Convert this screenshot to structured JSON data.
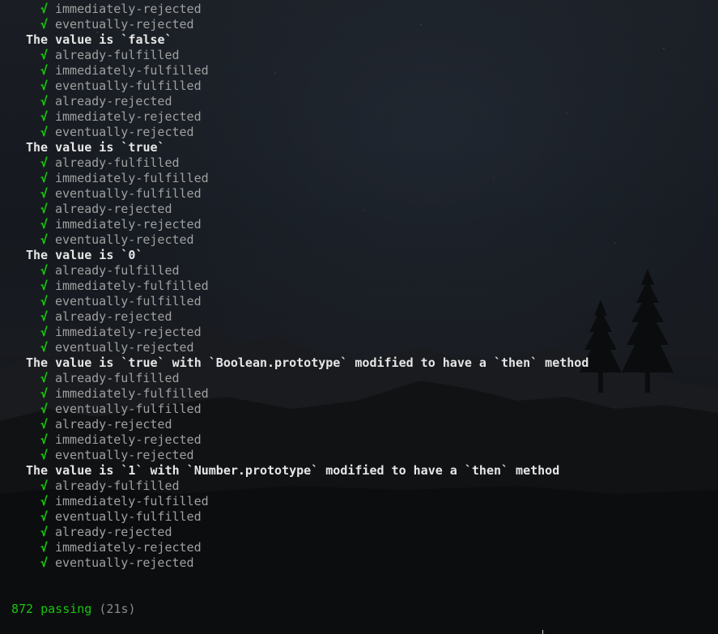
{
  "terminal": {
    "check_glyph": "√",
    "colors": {
      "pass_green": "#16c60c",
      "test_name": "#a0a0a0",
      "suite_title": "#e6e6e6"
    },
    "leading_tests": [
      "immediately-rejected",
      "eventually-rejected"
    ],
    "suites": [
      {
        "title": "The value is `false`",
        "tests": [
          "already-fulfilled",
          "immediately-fulfilled",
          "eventually-fulfilled",
          "already-rejected",
          "immediately-rejected",
          "eventually-rejected"
        ]
      },
      {
        "title": "The value is `true`",
        "tests": [
          "already-fulfilled",
          "immediately-fulfilled",
          "eventually-fulfilled",
          "already-rejected",
          "immediately-rejected",
          "eventually-rejected"
        ]
      },
      {
        "title": "The value is `0`",
        "tests": [
          "already-fulfilled",
          "immediately-fulfilled",
          "eventually-fulfilled",
          "already-rejected",
          "immediately-rejected",
          "eventually-rejected"
        ]
      },
      {
        "title": "The value is `true` with `Boolean.prototype` modified to have a `then` method",
        "tests": [
          "already-fulfilled",
          "immediately-fulfilled",
          "eventually-fulfilled",
          "already-rejected",
          "immediately-rejected",
          "eventually-rejected"
        ]
      },
      {
        "title": "The value is `1` with `Number.prototype` modified to have a `then` method",
        "tests": [
          "already-fulfilled",
          "immediately-fulfilled",
          "eventually-fulfilled",
          "already-rejected",
          "immediately-rejected",
          "eventually-rejected"
        ]
      }
    ],
    "summary": {
      "passing": "872 passing",
      "duration": "(21s)"
    }
  }
}
